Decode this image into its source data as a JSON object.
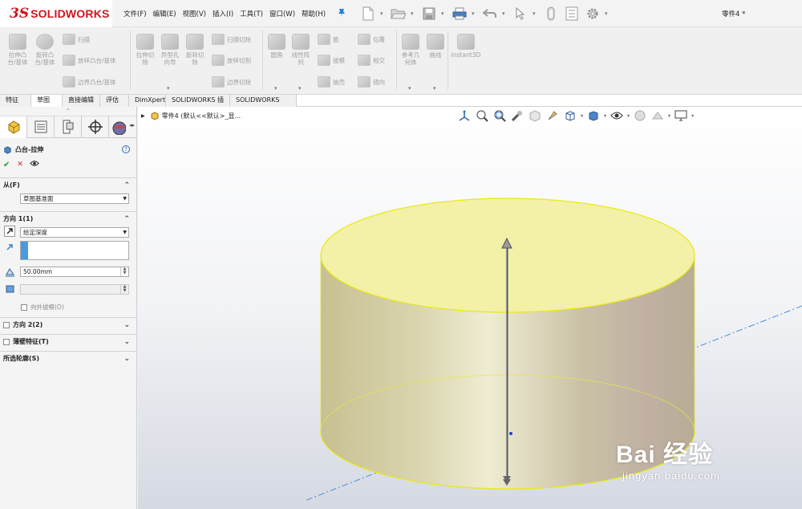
{
  "app": {
    "logo_mark": "3S",
    "logo_text": "SOLIDWORKS",
    "document_title": "零件4 *"
  },
  "menu": [
    "文件(F)",
    "编辑(E)",
    "视图(V)",
    "插入(I)",
    "工具(T)",
    "窗口(W)",
    "帮助(H)"
  ],
  "quick_access": {
    "icons": [
      "new-icon",
      "open-icon",
      "save-icon",
      "print-icon",
      "undo-icon",
      "select-icon",
      "rebuild-icon",
      "file-properties-icon",
      "options-icon"
    ]
  },
  "ribbon": {
    "commands": {
      "extrude_boss": "拉伸凸\n台/基体",
      "revolve_boss": "旋转凸\n台/基体",
      "sweep": "扫描",
      "loft_boss": "放样凸台/基体",
      "boundary_boss": "边界凸台/基体",
      "extrude_cut": "拉伸切\n除",
      "hole_wizard": "异型孔\n向导",
      "revolve_cut": "旋转切\n除",
      "swept_cut": "扫描切除",
      "lofted_cut": "放样切割",
      "boundary_cut": "边界切除",
      "fillet": "圆角",
      "linear_pattern": "线性阵\n列",
      "rib": "筋",
      "draft": "拔模",
      "shell": "抽壳",
      "wrap": "包覆",
      "intersect": "相交",
      "mirror": "镜向",
      "reference_geometry": "参考几\n何体",
      "curves": "曲线",
      "instant3d": "Instant3D"
    }
  },
  "tabs": [
    "特征",
    "草图",
    "直接编辑",
    "评估",
    "DimXpert",
    "SOLIDWORKS 插件",
    "SOLIDWORKS MBD"
  ],
  "active_tab": "特征",
  "property_manager": {
    "title": "凸台-拉伸",
    "help": "?",
    "ok": "✔",
    "cancel": "✕",
    "preview": "👁",
    "from": {
      "title": "从(F)",
      "value": "草图基准面"
    },
    "direction1": {
      "title": "方向 1(1)",
      "end_condition": "给定深度",
      "depth": "50.00mm",
      "draft_outward": "向外拔模(O)"
    },
    "direction2": {
      "title": "方向 2(2)"
    },
    "thin_feature": {
      "title": "薄壁特征(T)"
    },
    "selected_contours": {
      "title": "所选轮廓(S)"
    }
  },
  "feature_tree": {
    "label": "零件4  (默认<<默认>_显..."
  },
  "watermark": {
    "brand": "Bai 经验",
    "site": "jingyan.baidu.com"
  },
  "colors": {
    "brand_red": "#d2141e",
    "selection_yellow": "#f0f000",
    "preview_face": "#f3f0a8",
    "accent_blue": "#2e7fd0"
  }
}
